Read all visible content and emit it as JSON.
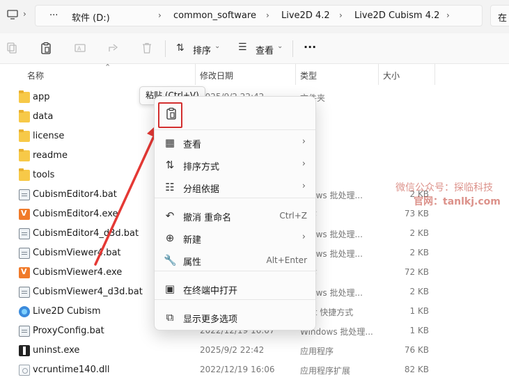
{
  "address": {
    "more": "···",
    "crumbs": [
      "软件 (D:)",
      "common_software",
      "Live2D 4.2",
      "Live2D Cubism 4.2"
    ],
    "search_partial": "在"
  },
  "toolbar": {
    "sort_label": "排序",
    "view_label": "查看",
    "more": "···"
  },
  "columns": {
    "name": "名称",
    "date": "修改日期",
    "type": "类型",
    "size": "大小"
  },
  "files": [
    {
      "name": "app",
      "icon": "folder-icon",
      "date": "2025/9/2 22:42",
      "type": "文件夹",
      "size": ""
    },
    {
      "name": "data",
      "icon": "folder-icon",
      "date": "",
      "type": "夹",
      "size": ""
    },
    {
      "name": "license",
      "icon": "folder-icon",
      "date": "",
      "type": "夹",
      "size": ""
    },
    {
      "name": "readme",
      "icon": "folder-icon",
      "date": "",
      "type": "夹",
      "size": ""
    },
    {
      "name": "tools",
      "icon": "folder-icon",
      "date": "",
      "type": "夹",
      "size": ""
    },
    {
      "name": "CubismEditor4.bat",
      "icon": "bat-icon",
      "date": "",
      "type": "ndows 批处理...",
      "size": "2 KB"
    },
    {
      "name": "CubismEditor4.exe",
      "icon": "exe-icon",
      "date": "",
      "type": "程序",
      "size": "73 KB"
    },
    {
      "name": "CubismEditor4_d3d.bat",
      "icon": "bat-icon",
      "date": "",
      "type": "ndows 批处理...",
      "size": "2 KB"
    },
    {
      "name": "CubismViewer4.bat",
      "icon": "bat-icon",
      "date": "",
      "type": "ndows 批处理...",
      "size": "2 KB"
    },
    {
      "name": "CubismViewer4.exe",
      "icon": "exe-icon",
      "date": "",
      "type": "程序",
      "size": "72 KB"
    },
    {
      "name": "CubismViewer4_d3d.bat",
      "icon": "bat-icon",
      "date": "",
      "type": "ndows 批处理...",
      "size": "2 KB"
    },
    {
      "name": "Live2D Cubism",
      "icon": "shortcut-icon",
      "date": "",
      "type": "rnet 快捷方式",
      "size": "1 KB"
    },
    {
      "name": "ProxyConfig.bat",
      "icon": "bat-icon",
      "date": "2022/12/19 16:07",
      "type": "Windows 批处理...",
      "size": "1 KB"
    },
    {
      "name": "uninst.exe",
      "icon": "uninstaller-icon",
      "date": "2025/9/2 22:42",
      "type": "应用程序",
      "size": "76 KB"
    },
    {
      "name": "vcruntime140.dll",
      "icon": "dll-icon",
      "date": "2022/12/19 16:06",
      "type": "应用程序扩展",
      "size": "82 KB"
    }
  ],
  "watermark": {
    "line1": "微信公众号：探临科技",
    "line2": "官网：tanlkj.com"
  },
  "tooltip": "粘贴 (Ctrl+V)",
  "context_menu": [
    {
      "label": "查看",
      "icon": "grid-icon",
      "shortcut": "",
      "submenu": true
    },
    {
      "label": "排序方式",
      "icon": "sort-icon",
      "shortcut": "",
      "submenu": true
    },
    {
      "label": "分组依据",
      "icon": "group-icon",
      "shortcut": "",
      "submenu": true
    },
    {
      "label": "撤消 重命名",
      "icon": "undo-icon",
      "shortcut": "Ctrl+Z",
      "submenu": false
    },
    {
      "label": "新建",
      "icon": "new-icon",
      "shortcut": "",
      "submenu": true
    },
    {
      "label": "属性",
      "icon": "wrench-icon",
      "shortcut": "Alt+Enter",
      "submenu": false
    },
    {
      "label": "在终端中打开",
      "icon": "terminal-icon",
      "shortcut": "",
      "submenu": false
    },
    {
      "label": "显示更多选项",
      "icon": "more-options-icon",
      "shortcut": "",
      "submenu": false
    }
  ],
  "colors": {
    "accent": "#d32f2f",
    "folder": "#f7c948",
    "watermark": "#c0392b"
  }
}
